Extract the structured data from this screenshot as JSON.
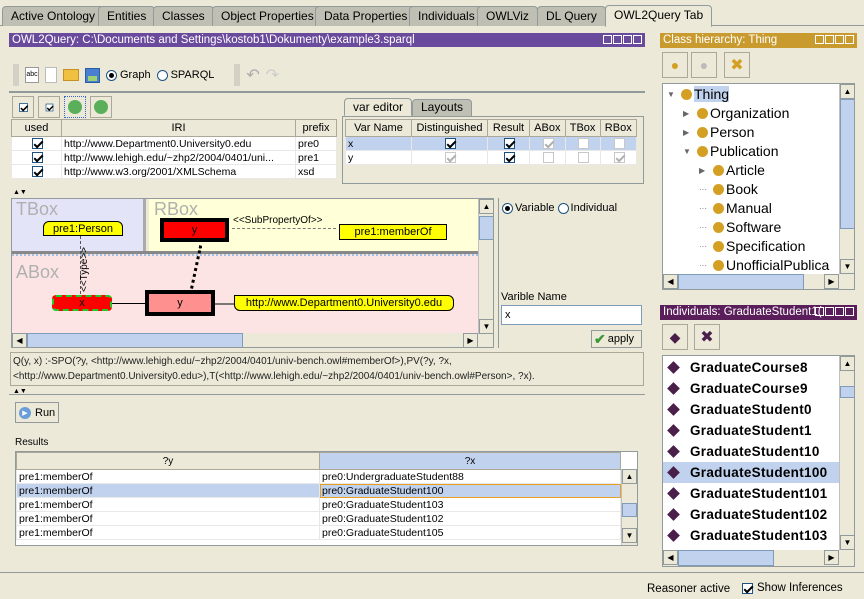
{
  "tabs": [
    "Active Ontology",
    "Entities",
    "Classes",
    "Object Properties",
    "Data Properties",
    "Individuals",
    "OWLViz",
    "DL Query",
    "OWL2Query Tab"
  ],
  "active_tab": "OWL2Query Tab",
  "query_panel": {
    "title": "OWL2Query: C:\\Documents and Settings\\kostob1\\Dokumenty\\example3.sparql",
    "title_color": "#6a4a9c",
    "toolbar": {
      "icons": [
        "abc-icon",
        "new-file-icon",
        "open-folder-icon",
        "save-icon"
      ],
      "mode_graph": "Graph",
      "mode_sparql": "SPARQL",
      "selected_mode": "Graph"
    },
    "prefix_table": {
      "columns": [
        "used",
        "IRI",
        "prefix"
      ],
      "rows": [
        {
          "used": true,
          "iri": "http://www.Department0.University0.edu",
          "prefix": "pre0"
        },
        {
          "used": true,
          "iri": "http://www.lehigh.edu/~zhp2/2004/0401/uni...",
          "prefix": "pre1"
        },
        {
          "used": true,
          "iri": "http://www.w3.org/2001/XMLSchema",
          "prefix": "xsd"
        }
      ]
    },
    "var_tabs": [
      "var editor",
      "Layouts"
    ],
    "var_table": {
      "columns": [
        "Var Name",
        "Distinguished",
        "Result",
        "ABox",
        "TBox",
        "RBox"
      ],
      "rows": [
        {
          "name": "x",
          "distinguished": true,
          "result": true,
          "abox": true,
          "tbox": false,
          "rbox": false
        },
        {
          "name": "y",
          "distinguished": true,
          "result": true,
          "abox": false,
          "tbox": false,
          "rbox": true
        }
      ]
    },
    "graph": {
      "tbox_label": "TBox",
      "rbox_label": "RBox",
      "abox_label": "ABox",
      "person_node": "pre1:Person",
      "rbox_y_node": "y",
      "subproperty_edge": "<<SubPropertyOf>>",
      "memberof_node": "pre1:memberOf",
      "type_edge": "<<Type>>",
      "abox_x_node": "x",
      "abox_y_node": "y",
      "dept_node": "http://www.Department0.University0.edu"
    },
    "node_editor": {
      "opt_variable": "Variable",
      "opt_individual": "Individual",
      "selected": "Variable",
      "name_label": "Varible Name",
      "name_value": "x",
      "apply_label": "apply"
    },
    "query_text": "Q(y, x) :-SPO(?y, <http://www.lehigh.edu/~zhp2/2004/0401/univ-bench.owl#memberOf>),PV(?y, ?x, <http://www.Department0.University0.edu>),T(<http://www.lehigh.edu/~zhp2/2004/0401/univ-bench.owl#Person>, ?x).",
    "run_label": "Run",
    "results_label": "Results",
    "results": {
      "columns": [
        "?y",
        "?x"
      ],
      "rows": [
        [
          "pre1:memberOf",
          "pre0:UndergraduateStudent88"
        ],
        [
          "pre1:memberOf",
          "pre0:GraduateStudent100"
        ],
        [
          "pre1:memberOf",
          "pre0:GraduateStudent103"
        ],
        [
          "pre1:memberOf",
          "pre0:GraduateStudent102"
        ],
        [
          "pre1:memberOf",
          "pre0:GraduateStudent105"
        ]
      ],
      "selected_row": 1
    }
  },
  "class_hierarchy": {
    "title": "Class hierarchy: Thing",
    "title_color": "#c99a2e",
    "items": [
      {
        "label": "Thing",
        "level": 0,
        "expander": "expanded",
        "selected": true
      },
      {
        "label": "Organization",
        "level": 1,
        "expander": "collapsed"
      },
      {
        "label": "Person",
        "level": 1,
        "expander": "collapsed"
      },
      {
        "label": "Publication",
        "level": 1,
        "expander": "expanded"
      },
      {
        "label": "Article",
        "level": 2,
        "expander": "collapsed"
      },
      {
        "label": "Book",
        "level": 2,
        "expander": "none"
      },
      {
        "label": "Manual",
        "level": 2,
        "expander": "none"
      },
      {
        "label": "Software",
        "level": 2,
        "expander": "none"
      },
      {
        "label": "Specification",
        "level": 2,
        "expander": "none"
      },
      {
        "label": "UnofficialPublica",
        "level": 2,
        "expander": "none"
      }
    ]
  },
  "individuals": {
    "title": "Individuals: GraduateStudent1(",
    "title_color": "#5a1f5a",
    "items": [
      "GraduateCourse8",
      "GraduateCourse9",
      "GraduateStudent0",
      "GraduateStudent1",
      "GraduateStudent10",
      "GraduateStudent100",
      "GraduateStudent101",
      "GraduateStudent102",
      "GraduateStudent103"
    ],
    "selected": "GraduateStudent100"
  },
  "status": {
    "reasoner": "Reasoner active",
    "show_inferences": "Show Inferences",
    "show_inferences_checked": true
  }
}
